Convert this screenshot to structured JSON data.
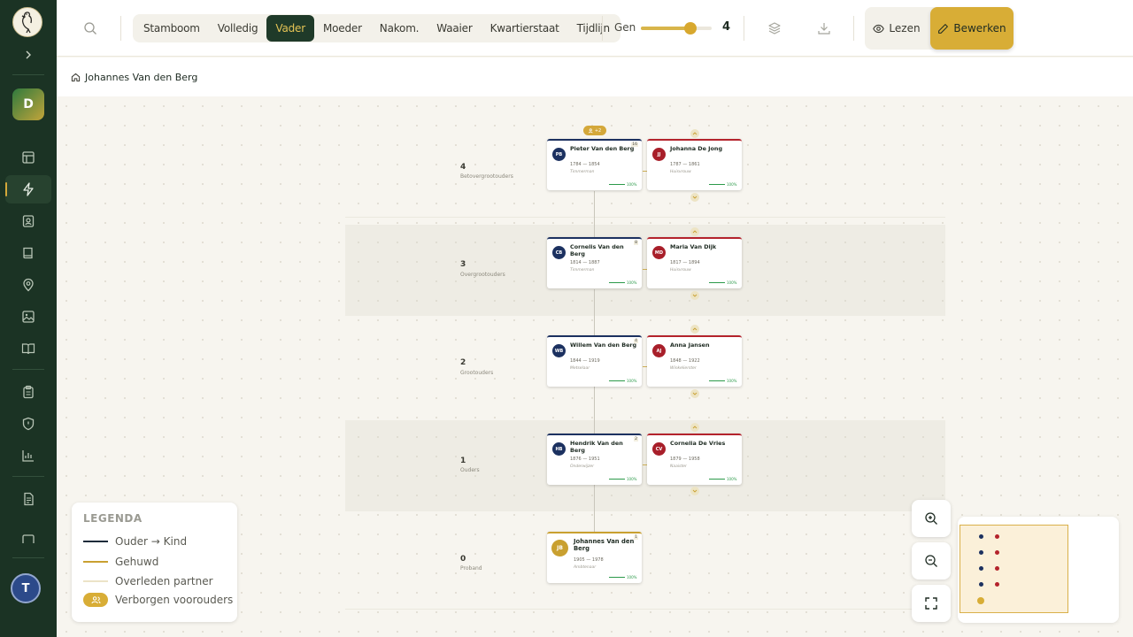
{
  "sidebar": {
    "workspace_initial": "D",
    "user_initial": "T",
    "items": [
      "layout-icon",
      "activity-icon",
      "contact-icon",
      "book-icon",
      "map-pin-icon",
      "image-icon",
      "book-open-icon",
      "clipboard-icon",
      "shield-icon",
      "chart-icon",
      "file-text-icon",
      "mail-icon"
    ]
  },
  "toolbar": {
    "tabs": [
      "Stamboom",
      "Volledig",
      "Vader",
      "Moeder",
      "Nakom.",
      "Waaier",
      "Kwartierstaat",
      "Tijdlijn"
    ],
    "active_tab": "Vader",
    "gen_label": "Gen",
    "gen_value": "4",
    "gen_slider_fraction": 0.7,
    "read_label": "Lezen",
    "edit_label": "Bewerken"
  },
  "breadcrumb": {
    "label": "Johannes Van den Berg"
  },
  "generations": [
    {
      "num": "4",
      "name": "Betovergrootouders"
    },
    {
      "num": "3",
      "name": "Overgrootouders"
    },
    {
      "num": "2",
      "name": "Grootouders"
    },
    {
      "num": "1",
      "name": "Ouders"
    },
    {
      "num": "0",
      "name": "Proband"
    }
  ],
  "hidden_badge": "+2",
  "persons": [
    {
      "initials": "PB",
      "name": "Pieter Van den Berg",
      "dates": "1784 — 1854",
      "occupation": "Timmerman",
      "pct": "100%",
      "badge": "16",
      "sex": "m"
    },
    {
      "initials": "JJ",
      "name": "Johanna De Jong",
      "dates": "1787 — 1861",
      "occupation": "Huisvrouw",
      "pct": "100%",
      "badge": "",
      "sex": "f"
    },
    {
      "initials": "CB",
      "name": "Cornelis Van den Berg",
      "dates": "1814 — 1887",
      "occupation": "Timmerman",
      "pct": "100%",
      "badge": "8",
      "sex": "m"
    },
    {
      "initials": "MD",
      "name": "Maria Van Dijk",
      "dates": "1817 — 1894",
      "occupation": "Huisvrouw",
      "pct": "100%",
      "badge": "",
      "sex": "f"
    },
    {
      "initials": "WB",
      "name": "Willem Van den Berg",
      "dates": "1844 — 1919",
      "occupation": "Metselaar",
      "pct": "100%",
      "badge": "4",
      "sex": "m"
    },
    {
      "initials": "AJ",
      "name": "Anna Jansen",
      "dates": "1848 — 1922",
      "occupation": "Winkelierster",
      "pct": "100%",
      "badge": "",
      "sex": "f"
    },
    {
      "initials": "HB",
      "name": "Hendrik Van den Berg",
      "dates": "1876 — 1951",
      "occupation": "Onderwijzer",
      "pct": "100%",
      "badge": "2",
      "sex": "m"
    },
    {
      "initials": "CV",
      "name": "Cornelia De Vries",
      "dates": "1879 — 1958",
      "occupation": "Naaister",
      "pct": "100%",
      "badge": "",
      "sex": "f"
    },
    {
      "initials": "JB",
      "name": "Johannes Van den Berg",
      "dates": "1905 — 1978",
      "occupation": "Ambtenaar",
      "pct": "100%",
      "badge": "1",
      "sex": "p"
    }
  ],
  "legend": {
    "title": "LEGENDA",
    "items": [
      {
        "label": "Ouder → Kind",
        "color": "#1e2b3a"
      },
      {
        "label": "Gehuwd",
        "color": "#c9a030"
      },
      {
        "label": "Overleden partner",
        "color": "#ece3c7"
      },
      {
        "label": "Verborgen voorouders",
        "color": "#d8ad36"
      }
    ]
  },
  "colors": {
    "sidebar": "#1b3324",
    "accent": "#d8ad36",
    "male": "#1c3160",
    "female": "#b4232c"
  }
}
